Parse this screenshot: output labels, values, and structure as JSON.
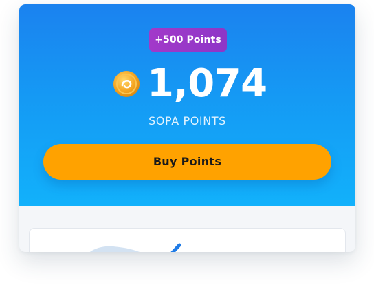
{
  "bonus_badge": {
    "label": "+500 Points"
  },
  "balance": {
    "value": "1,074",
    "label": "SOPA POINTS",
    "coin_icon": "coin-icon"
  },
  "actions": {
    "buy_label": "Buy Points"
  },
  "colors": {
    "hero_top": "#1b82ef",
    "hero_bottom": "#12b1fb",
    "badge": "#9b38c8",
    "button": "#ffa200",
    "coin": "#f5a623"
  },
  "lower_card": {
    "illustration_icon": "checkmark-illustration-icon"
  }
}
